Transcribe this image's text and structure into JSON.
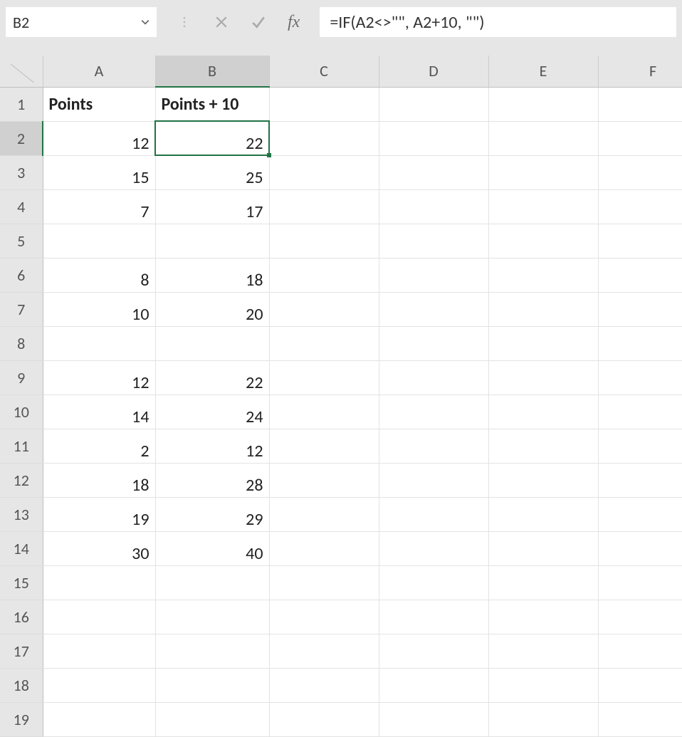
{
  "name_box": {
    "ref": "B2"
  },
  "formula_bar": {
    "fx_label": "fx",
    "content": "=IF(A2<>\"\", A2+10, \"\")"
  },
  "columns": [
    "A",
    "B",
    "C",
    "D",
    "E",
    "F"
  ],
  "selected_col_index": 1,
  "rows": [
    {
      "n": "1",
      "A": "Points",
      "B": "Points + 10"
    },
    {
      "n": "2",
      "A": "12",
      "B": "22"
    },
    {
      "n": "3",
      "A": "15",
      "B": "25"
    },
    {
      "n": "4",
      "A": "7",
      "B": "17"
    },
    {
      "n": "5",
      "A": "",
      "B": ""
    },
    {
      "n": "6",
      "A": "8",
      "B": "18"
    },
    {
      "n": "7",
      "A": "10",
      "B": "20"
    },
    {
      "n": "8",
      "A": "",
      "B": ""
    },
    {
      "n": "9",
      "A": "12",
      "B": "22"
    },
    {
      "n": "10",
      "A": "14",
      "B": "24"
    },
    {
      "n": "11",
      "A": "2",
      "B": "12"
    },
    {
      "n": "12",
      "A": "18",
      "B": "28"
    },
    {
      "n": "13",
      "A": "19",
      "B": "29"
    },
    {
      "n": "14",
      "A": "30",
      "B": "40"
    },
    {
      "n": "15",
      "A": "",
      "B": ""
    },
    {
      "n": "16",
      "A": "",
      "B": ""
    },
    {
      "n": "17",
      "A": "",
      "B": ""
    },
    {
      "n": "18",
      "A": "",
      "B": ""
    },
    {
      "n": "19",
      "A": "",
      "B": ""
    }
  ],
  "selected_row_index": 1,
  "selected_cell": {
    "row": 1,
    "col": "B"
  }
}
